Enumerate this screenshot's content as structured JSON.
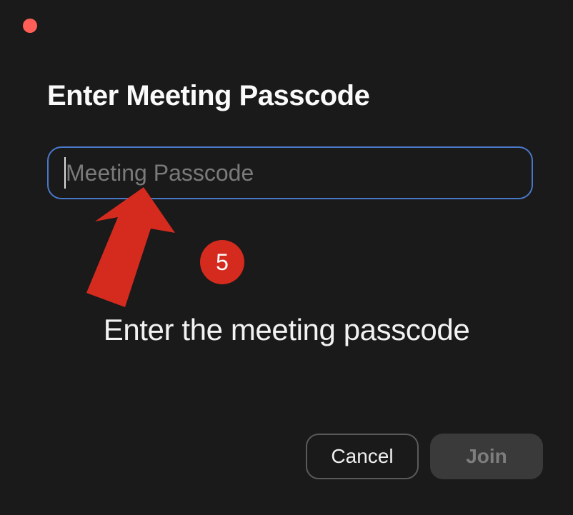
{
  "dialog": {
    "title": "Enter Meeting Passcode",
    "passcode_value": "",
    "passcode_placeholder": "Meeting Passcode",
    "cancel_label": "Cancel",
    "join_label": "Join"
  },
  "annotation": {
    "step_number": "5",
    "caption": "Enter the meeting passcode"
  },
  "colors": {
    "accent_focus": "#4a78c9",
    "annotation_red": "#d52b1e",
    "traffic_light_red": "#ff5f57"
  }
}
